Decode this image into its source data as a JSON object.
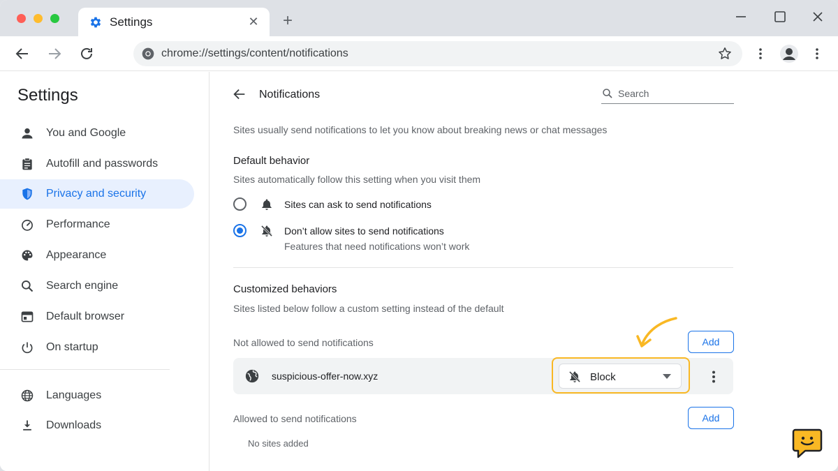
{
  "browser": {
    "tab_title": "Settings",
    "url": "chrome://settings/content/notifications"
  },
  "sidebar": {
    "title": "Settings",
    "items": [
      {
        "label": "You and Google",
        "icon": "person-icon"
      },
      {
        "label": "Autofill and passwords",
        "icon": "clipboard-icon"
      },
      {
        "label": "Privacy and security",
        "icon": "shield-icon",
        "active": true
      },
      {
        "label": "Performance",
        "icon": "speedometer-icon"
      },
      {
        "label": "Appearance",
        "icon": "palette-icon"
      },
      {
        "label": "Search engine",
        "icon": "search-icon"
      },
      {
        "label": "Default browser",
        "icon": "browser-window-icon"
      },
      {
        "label": "On startup",
        "icon": "power-icon"
      },
      {
        "label": "Languages",
        "icon": "globe-icon"
      },
      {
        "label": "Downloads",
        "icon": "download-icon"
      }
    ]
  },
  "main": {
    "title": "Notifications",
    "search_placeholder": "Search",
    "intro": "Sites usually send notifications to let you know about breaking news or chat messages",
    "default_behavior": {
      "heading": "Default behavior",
      "subtitle": "Sites automatically follow this setting when you visit them",
      "options": [
        {
          "label": "Sites can ask to send notifications",
          "icon": "bell-icon",
          "checked": false
        },
        {
          "label": "Don’t allow sites to send notifications",
          "sublabel": "Features that need notifications won’t work",
          "icon": "bell-off-icon",
          "checked": true
        }
      ]
    },
    "customized": {
      "heading": "Customized behaviors",
      "subtitle": "Sites listed below follow a custom setting instead of the default",
      "not_allowed_label": "Not allowed to send notifications",
      "allowed_label": "Allowed to send notifications",
      "add_label": "Add",
      "blocked_sites": [
        {
          "site": "suspicious-offer-now.xyz",
          "permission": "Block"
        }
      ],
      "allowed_empty": "No sites added"
    }
  },
  "colors": {
    "accent": "#1a73e8",
    "active_bg": "#e8f0fe",
    "highlight": "#f9b824"
  }
}
